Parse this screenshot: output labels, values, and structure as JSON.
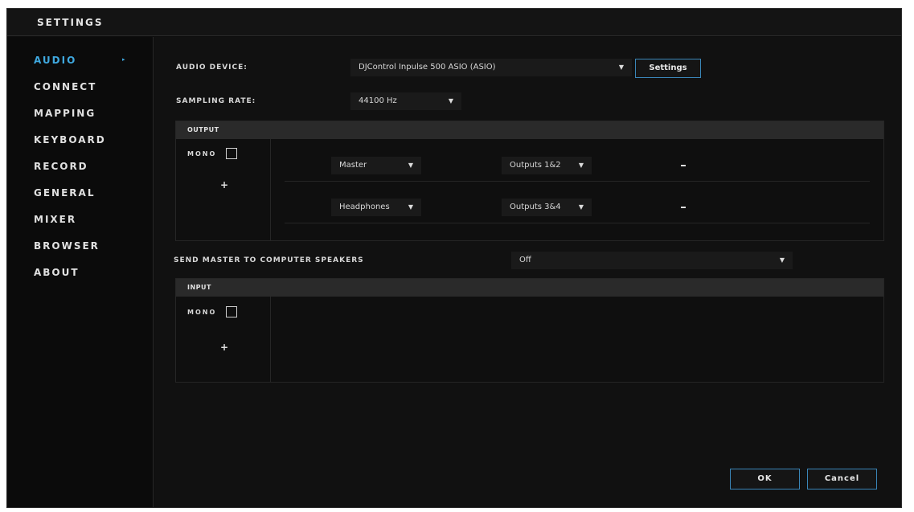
{
  "window": {
    "title": "SETTINGS"
  },
  "sidebar": {
    "items": [
      {
        "label": "AUDIO",
        "active": true
      },
      {
        "label": "CONNECT"
      },
      {
        "label": "MAPPING"
      },
      {
        "label": "KEYBOARD"
      },
      {
        "label": "RECORD"
      },
      {
        "label": "GENERAL"
      },
      {
        "label": "MIXER"
      },
      {
        "label": "BROWSER"
      },
      {
        "label": "ABOUT"
      }
    ],
    "active_arrow": "▸"
  },
  "audio": {
    "device_label": "AUDIO DEVICE:",
    "device_value": "DJControl Inpulse 500 ASIO (ASIO)",
    "settings_label": "Settings",
    "sampling_label": "SAMPLING RATE:",
    "sampling_value": "44100 Hz",
    "output": {
      "header": "OUTPUT",
      "mono_label": "MONO",
      "mono_checked": false,
      "add_symbol": "+",
      "rows": [
        {
          "channel": "Master",
          "outputs": "Outputs 1&2"
        },
        {
          "channel": "Headphones",
          "outputs": "Outputs 3&4"
        }
      ]
    },
    "send_master_label": "SEND MASTER TO COMPUTER SPEAKERS",
    "send_master_value": "Off",
    "input": {
      "header": "INPUT",
      "mono_label": "MONO",
      "mono_checked": false,
      "add_symbol": "+"
    }
  },
  "footer": {
    "ok_label": "OK",
    "cancel_label": "Cancel"
  },
  "icons": {
    "dropdown": "▼"
  },
  "colors": {
    "accent": "#3fa9e0",
    "button_border": "#3a86b8",
    "background": "#0d0d0d"
  }
}
